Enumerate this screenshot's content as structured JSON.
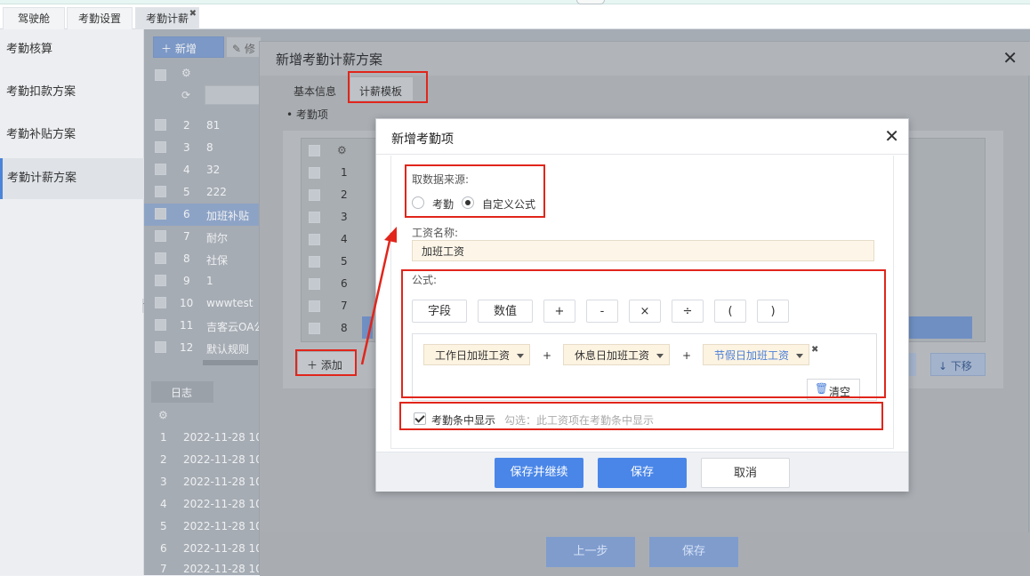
{
  "tabs": [
    {
      "label": "驾驶舱"
    },
    {
      "label": "考勤设置"
    },
    {
      "label": "考勤计薪"
    }
  ],
  "sidebar": {
    "items": [
      {
        "label": "考勤核算"
      },
      {
        "label": "考勤扣款方案"
      },
      {
        "label": "考勤补贴方案"
      },
      {
        "label": "考勤计薪方案"
      }
    ]
  },
  "background": {
    "toolbar": {
      "add_label": "新增",
      "edit_label": "修"
    },
    "rows": [
      {
        "no": "2",
        "name": "81"
      },
      {
        "no": "3",
        "name": "8"
      },
      {
        "no": "4",
        "name": "32"
      },
      {
        "no": "5",
        "name": "222"
      },
      {
        "no": "6",
        "name": "加班补贴"
      },
      {
        "no": "7",
        "name": "耐尔"
      },
      {
        "no": "8",
        "name": "社保"
      },
      {
        "no": "9",
        "name": "1"
      },
      {
        "no": "10",
        "name": "wwwtest"
      },
      {
        "no": "11",
        "name": "吉客云OA公"
      },
      {
        "no": "12",
        "name": "默认规则"
      }
    ],
    "log_tab": "日志",
    "log_rows": [
      {
        "no": "1",
        "time": "2022-11-28 10"
      },
      {
        "no": "2",
        "time": "2022-11-28 10"
      },
      {
        "no": "3",
        "time": "2022-11-28 10"
      },
      {
        "no": "4",
        "time": "2022-11-28 10"
      },
      {
        "no": "5",
        "time": "2022-11-28 10"
      },
      {
        "no": "6",
        "time": "2022-11-28 10"
      },
      {
        "no": "7",
        "time": "2022-11-28 10"
      }
    ]
  },
  "outer_dialog": {
    "title": "新增考勤计薪方案",
    "tabs": [
      {
        "label": "基本信息"
      },
      {
        "label": "计薪模板"
      }
    ],
    "section_label": "考勤项",
    "table_rows": [
      "1",
      "2",
      "3",
      "4",
      "5",
      "6",
      "7",
      "8"
    ],
    "add_label": "添加",
    "down_label": "下移",
    "prev_label": "上一步",
    "save_label": "保存"
  },
  "inner_dialog": {
    "title": "新增考勤项",
    "source_label": "取数据来源:",
    "source_options": [
      {
        "label": "考勤",
        "checked": false
      },
      {
        "label": "自定义公式",
        "checked": true
      }
    ],
    "salary_name_label": "工资名称:",
    "salary_name_value": "加班工资",
    "formula_label": "公式:",
    "operators": [
      "字段",
      "数值",
      "+",
      "-",
      "×",
      "÷",
      "(",
      ")"
    ],
    "formula_tokens": [
      {
        "label": "工作日加班工资"
      },
      {
        "label": "休息日加班工资"
      },
      {
        "label": "节假日加班工资"
      }
    ],
    "formula_plus": [
      "+",
      "+"
    ],
    "clear_label": "清空",
    "show_label": "考勤条中显示",
    "show_hint": "勾选：此工资项在考勤条中显示",
    "show_checked": true,
    "buttons": {
      "save_continue": "保存并继续",
      "save": "保存",
      "cancel": "取消"
    }
  },
  "colors": {
    "primary": "#4a86e8",
    "annotation": "#e1251b",
    "input_bg": "#fdf6e8"
  }
}
